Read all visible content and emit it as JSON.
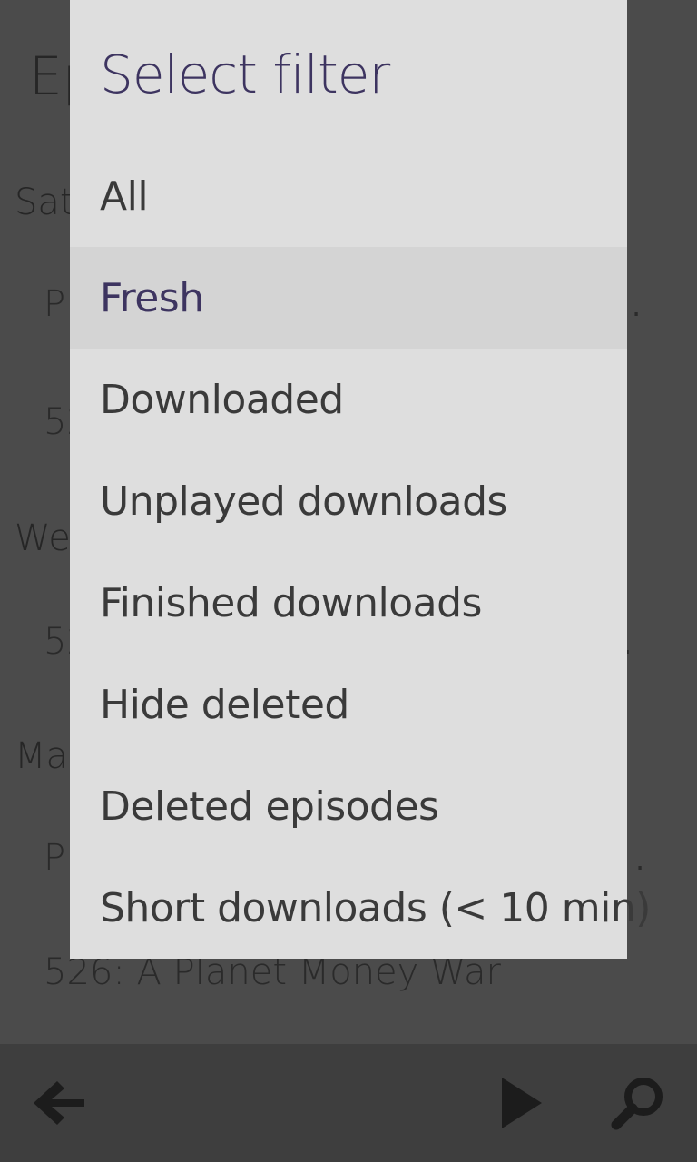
{
  "background": {
    "title": "Ep",
    "sections": [
      {
        "label": "Sat"
      },
      {
        "label": "We"
      },
      {
        "label": "Ma"
      }
    ],
    "items": [
      {
        "label": "P"
      },
      {
        "label": "52"
      },
      {
        "label": "52"
      },
      {
        "label": "P"
      },
      {
        "label": "526: A Planet Money War"
      }
    ],
    "ellipsis": "."
  },
  "dialog": {
    "title": "Select filter",
    "options": [
      {
        "label": "All"
      },
      {
        "label": "Fresh"
      },
      {
        "label": "Downloaded"
      },
      {
        "label": "Unplayed downloads"
      },
      {
        "label": "Finished downloads"
      },
      {
        "label": "Hide deleted"
      },
      {
        "label": "Deleted episodes"
      },
      {
        "label": "Short downloads (< 10 min)"
      }
    ],
    "selected": "Fresh"
  },
  "toolbar": {
    "icons": [
      "back-arrow-icon",
      "play-icon",
      "search-icon"
    ]
  },
  "colors": {
    "accent": "#3d3460",
    "dialog_bg": "#dedede",
    "selected_bg": "#d4d4d4",
    "overlay_bg": "#4b4b4b"
  }
}
